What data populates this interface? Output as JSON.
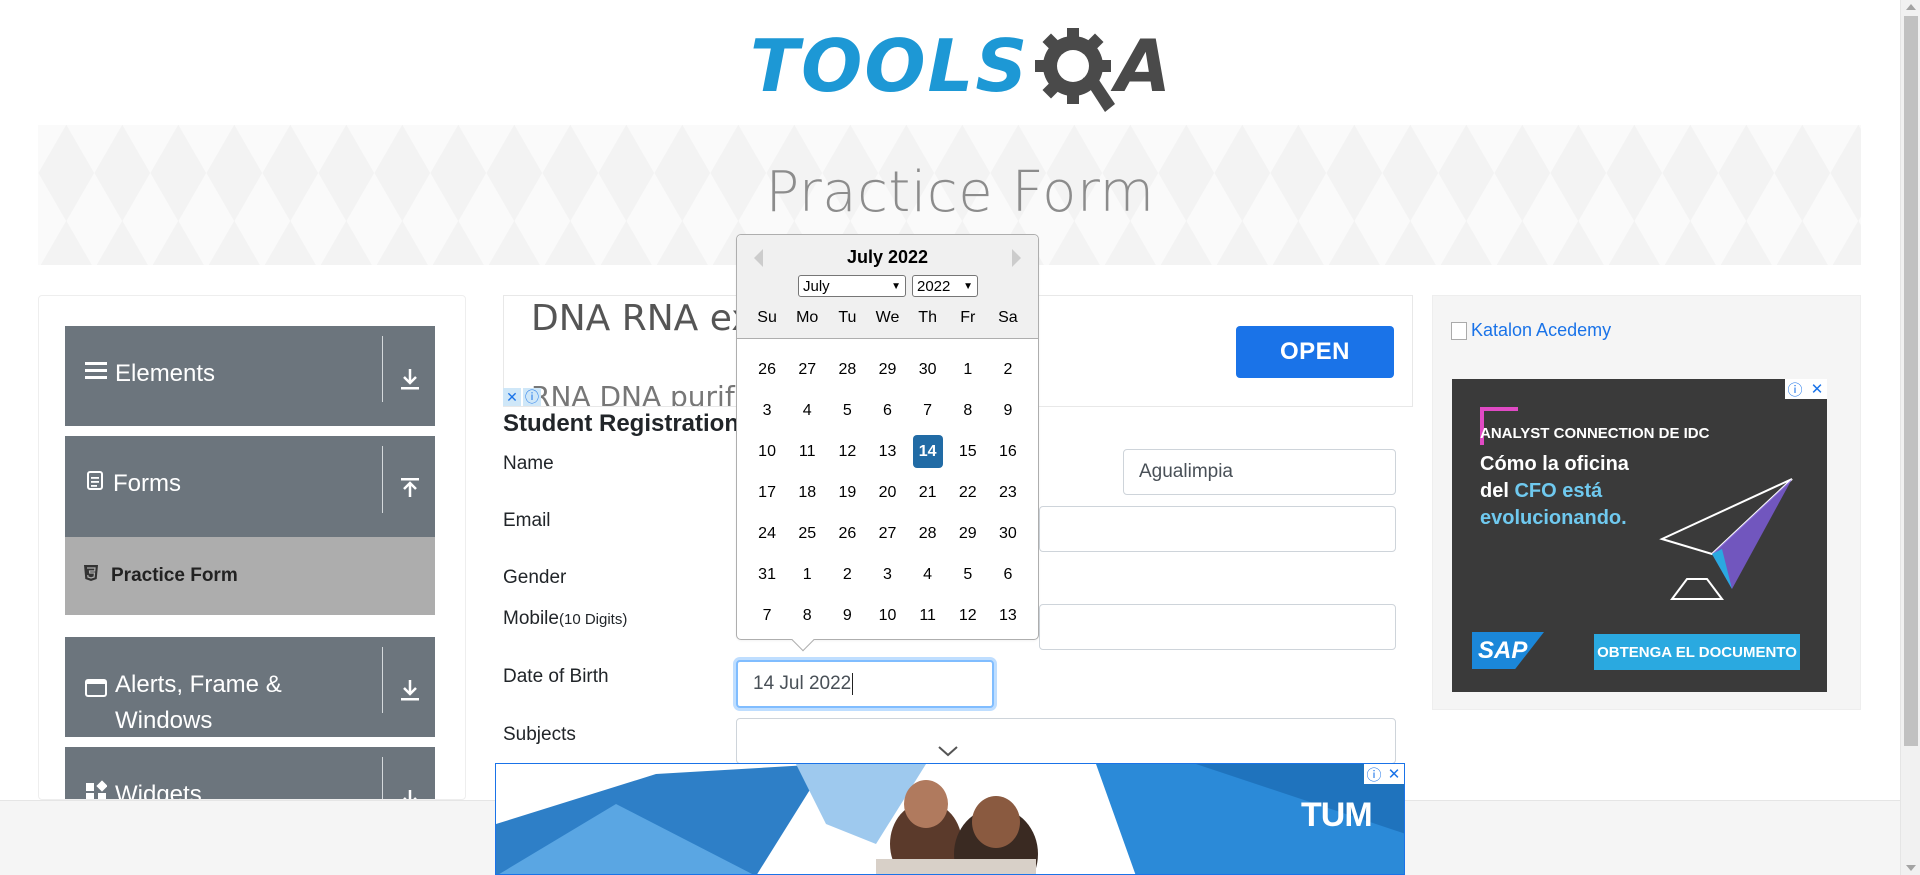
{
  "logo": {
    "part1": "TOOLS",
    "part2": "A"
  },
  "banner": {
    "title": "Practice Form"
  },
  "sidebar": {
    "groups": [
      {
        "label": "Elements",
        "icon": "bars-icon",
        "arrow": "download-icon"
      },
      {
        "label": "Forms",
        "icon": "document-icon",
        "arrow": "upload-icon"
      },
      {
        "label": "Alerts, Frame &",
        "label2": "Windows",
        "icon": "window-icon",
        "arrow": "download-icon"
      },
      {
        "label": "Widgets",
        "icon": "widgets-icon",
        "arrow": "download-icon"
      }
    ],
    "active_item": "Practice Form"
  },
  "ad_top": {
    "line1": "DNA RNA ex",
    "line2": "RNA DNA purif",
    "cta": "OPEN"
  },
  "form": {
    "title": "Student Registration",
    "name_label": "Name",
    "last_name_value": "Agualimpia",
    "email_label": "Email",
    "gender_label": "Gender",
    "mobile_label": "Mobile",
    "mobile_hint": "(10 Digits)",
    "dob_label": "Date of Birth",
    "dob_value": "14 Jul 2022",
    "subjects_label": "Subjects"
  },
  "datepicker": {
    "current_month": "July 2022",
    "month_select": "July",
    "year_select": "2022",
    "weekdays": [
      "Su",
      "Mo",
      "Tu",
      "We",
      "Th",
      "Fr",
      "Sa"
    ],
    "weeks": [
      [
        "26",
        "27",
        "28",
        "29",
        "30",
        "1",
        "2"
      ],
      [
        "3",
        "4",
        "5",
        "6",
        "7",
        "8",
        "9"
      ],
      [
        "10",
        "11",
        "12",
        "13",
        "14",
        "15",
        "16"
      ],
      [
        "17",
        "18",
        "19",
        "20",
        "21",
        "22",
        "23"
      ],
      [
        "24",
        "25",
        "26",
        "27",
        "28",
        "29",
        "30"
      ],
      [
        "31",
        "1",
        "2",
        "3",
        "4",
        "5",
        "6"
      ],
      [
        "7",
        "8",
        "9",
        "10",
        "11",
        "12",
        "13"
      ]
    ],
    "selected_day": "14"
  },
  "right_ad": {
    "link_text": "Katalon Acedemy",
    "sap_headline": "ANALYST CONNECTION DE IDC",
    "sap_body_1": "Cómo la oficina",
    "sap_body_2": "del ",
    "sap_body_highlight": "CFO está",
    "sap_body_3": "evolucionando.",
    "sap_logo": "SAP",
    "sap_cta": "OBTENGA EL DOCUMENTO"
  },
  "bottom_ad": {
    "brand": "TUM"
  },
  "colors": {
    "sidebar_group": "#6c757d",
    "active_item": "#adadad",
    "selected_day": "#216ba5",
    "ad_cta": "#1a73e8",
    "logo_blue": "#1d98d5"
  }
}
